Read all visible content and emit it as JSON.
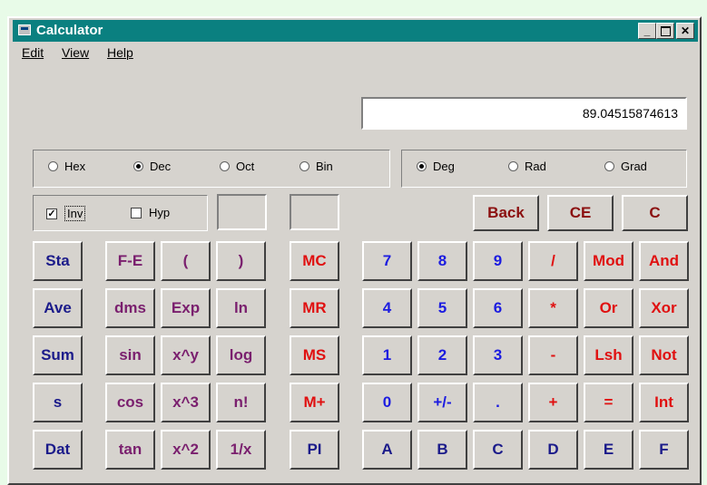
{
  "window": {
    "title": "Calculator"
  },
  "menu": [
    "Edit",
    "View",
    "Help"
  ],
  "display": {
    "value": "89.04515874613"
  },
  "base_radios": [
    {
      "label": "Hex",
      "selected": false
    },
    {
      "label": "Dec",
      "selected": true
    },
    {
      "label": "Oct",
      "selected": false
    },
    {
      "label": "Bin",
      "selected": false
    }
  ],
  "angle_radios": [
    {
      "label": "Deg",
      "selected": true
    },
    {
      "label": "Rad",
      "selected": false
    },
    {
      "label": "Grad",
      "selected": false
    }
  ],
  "checkboxes": [
    {
      "label": "Inv",
      "checked": true
    },
    {
      "label": "Hyp",
      "checked": false
    }
  ],
  "edit_buttons": [
    "Back",
    "CE",
    "C"
  ],
  "stat_buttons": [
    "Sta",
    "Ave",
    "Sum",
    "s",
    "Dat"
  ],
  "sci_col1": [
    "F-E",
    "dms",
    "sin",
    "cos",
    "tan"
  ],
  "sci_col2": [
    "(",
    "Exp",
    "x^y",
    "x^3",
    "x^2"
  ],
  "sci_col3": [
    ")",
    "ln",
    "log",
    "n!",
    "1/x"
  ],
  "memory_buttons": [
    "MC",
    "MR",
    "MS",
    "M+",
    "PI"
  ],
  "digit_rows": [
    [
      "7",
      "8",
      "9",
      "/",
      "Mod",
      "And"
    ],
    [
      "4",
      "5",
      "6",
      "*",
      "Or",
      "Xor"
    ],
    [
      "1",
      "2",
      "3",
      "-",
      "Lsh",
      "Not"
    ],
    [
      "0",
      "+/-",
      ".",
      "+",
      "=",
      "Int"
    ],
    [
      "A",
      "B",
      "C",
      "D",
      "E",
      "F"
    ]
  ]
}
